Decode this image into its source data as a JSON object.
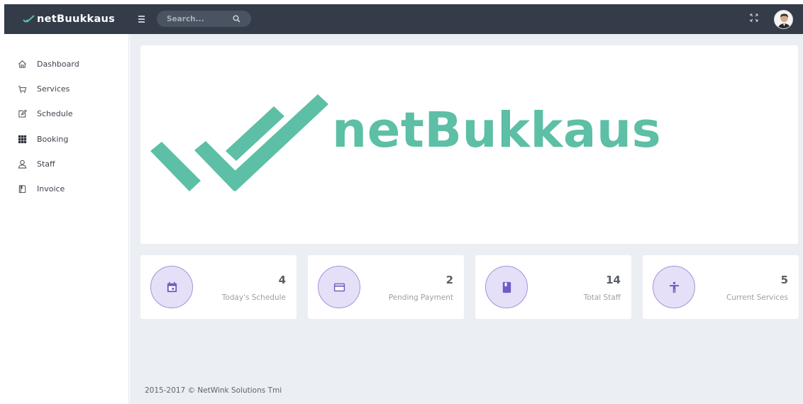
{
  "header": {
    "brand_name": "netBuukkaus",
    "search_placeholder": "Search..."
  },
  "sidebar": {
    "items": [
      {
        "label": "Dashboard",
        "icon": "home-icon"
      },
      {
        "label": "Services",
        "icon": "cart-icon"
      },
      {
        "label": "Schedule",
        "icon": "edit-icon"
      },
      {
        "label": "Booking",
        "icon": "grid-icon"
      },
      {
        "label": "Staff",
        "icon": "user-icon"
      },
      {
        "label": "Invoice",
        "icon": "book-icon"
      }
    ]
  },
  "hero": {
    "logo_text": "netBukkaus"
  },
  "stats": [
    {
      "value": "4",
      "label": "Today's Schedule",
      "icon": "calendar-icon"
    },
    {
      "value": "2",
      "label": "Pending Payment",
      "icon": "credit-card-icon"
    },
    {
      "value": "14",
      "label": "Total Staff",
      "icon": "book-icon"
    },
    {
      "value": "5",
      "label": "Current Services",
      "icon": "accessibility-icon"
    }
  ],
  "footer": {
    "text": "2015-2017 © NetWink Solutions Tmi"
  },
  "colors": {
    "topbar": "#343c49",
    "accent_teal": "#5dbfa5",
    "stat_circle": "#e5e0f7",
    "stat_icon": "#7b68c8",
    "main_bg": "#ebeef2"
  }
}
